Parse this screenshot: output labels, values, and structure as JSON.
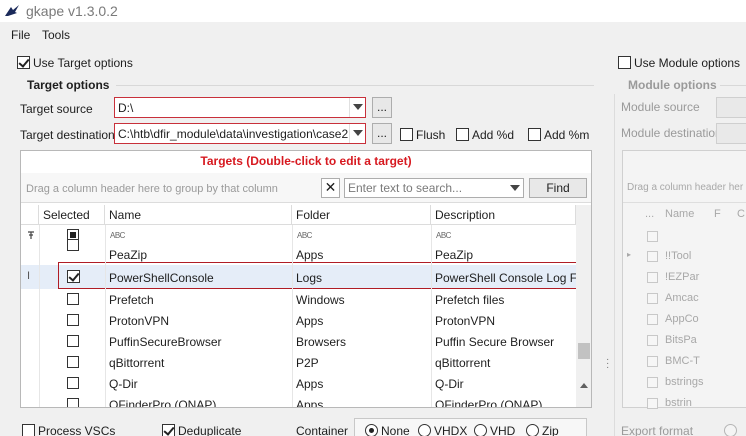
{
  "window": {
    "title": "gkape v1.3.0.2"
  },
  "menu": {
    "file": "File",
    "tools": "Tools"
  },
  "use_target_options": {
    "label": "Use Target options",
    "checked": true
  },
  "use_module_options": {
    "label": "Use Module options",
    "checked": false
  },
  "target_options": {
    "heading": "Target options",
    "source_label": "Target source",
    "source_value": "D:\\",
    "destination_label": "Target destination",
    "destination_value": "C:\\htb\\dfir_module\\data\\investigation\\case2",
    "browse": "...",
    "flush": "Flush",
    "add_pct_d": "Add %d",
    "add_pct_m": "Add %m"
  },
  "targets_grid": {
    "title": "Targets (Double-click to edit a target)",
    "group_hint": "Drag a column header here to group by that column",
    "search_placeholder": "Enter text to search...",
    "find_button": "Find",
    "columns": [
      "Selected",
      "Name",
      "Folder",
      "Description"
    ],
    "filter_glyph": "ABC",
    "rows": [
      {
        "selected": false,
        "name": "PeaZip",
        "folder": "Apps",
        "description": "PeaZip"
      },
      {
        "selected": true,
        "name": "PowerShellConsole",
        "folder": "Logs",
        "description": "PowerShell Console Log File"
      },
      {
        "selected": false,
        "name": "Prefetch",
        "folder": "Windows",
        "description": "Prefetch files"
      },
      {
        "selected": false,
        "name": "ProtonVPN",
        "folder": "Apps",
        "description": "ProtonVPN"
      },
      {
        "selected": false,
        "name": "PuffinSecureBrowser",
        "folder": "Browsers",
        "description": "Puffin Secure Browser"
      },
      {
        "selected": false,
        "name": "qBittorrent",
        "folder": "P2P",
        "description": "qBittorrent"
      },
      {
        "selected": false,
        "name": "Q-Dir",
        "folder": "Apps",
        "description": "Q-Dir"
      },
      {
        "selected": false,
        "name": "QFinderPro (QNAP)",
        "folder": "Apps",
        "description": "QFinderPro (QNAP)"
      }
    ]
  },
  "bottom_options": {
    "process_vscs": "Process VSCs",
    "deduplicate": "Deduplicate",
    "container_label": "Container",
    "container_options": [
      "None",
      "VHDX",
      "VHD",
      "Zip"
    ],
    "container_selected": "None"
  },
  "module_options": {
    "heading": "Module options",
    "source_label": "Module source",
    "destination_label": "Module destination",
    "group_hint": "Drag a column header her",
    "columns": [
      "Name",
      "F",
      "C"
    ],
    "rows": [
      "!!Tool",
      "!EZPar",
      "Amcac",
      "AppCo",
      "BitsPa",
      "BMC-T",
      "bstrings",
      "bstrin"
    ],
    "export_format": "Export format"
  },
  "colors": {
    "accent_red": "#d71920",
    "selection_outline": "#b01c25"
  }
}
